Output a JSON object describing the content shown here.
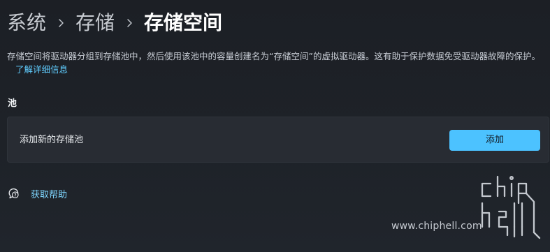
{
  "breadcrumb": {
    "items": [
      {
        "label": "系统"
      },
      {
        "label": "存储"
      },
      {
        "label": "存储空间"
      }
    ]
  },
  "description": {
    "text": "存储空间将驱动器分组到存储池中，然后使用该池中的容量创建名为“存储空间”的虚拟驱动器。这有助于保护数据免受驱动器故障的保护。",
    "link_label": "了解详细信息"
  },
  "pool_section": {
    "title": "池",
    "card_label": "添加新的存储池",
    "add_button_label": "添加"
  },
  "help": {
    "icon": "help-chat-icon",
    "label": "获取帮助"
  },
  "watermark": {
    "text": "www.chiphell.com",
    "logo": "chiphell-logo"
  },
  "colors": {
    "background": "#1d2026",
    "card": "#282c33",
    "accent": "#4cc2ff",
    "link": "#60cdff"
  }
}
